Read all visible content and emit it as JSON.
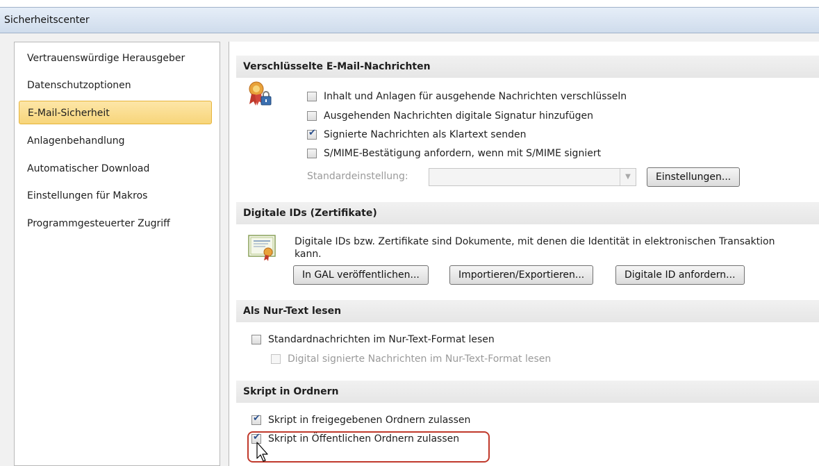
{
  "window": {
    "title": "Sicherheitscenter"
  },
  "sidebar": {
    "items": [
      {
        "label": "Vertrauenswürdige Herausgeber"
      },
      {
        "label": "Datenschutzoptionen"
      },
      {
        "label": "E-Mail-Sicherheit",
        "selected": true
      },
      {
        "label": "Anlagenbehandlung"
      },
      {
        "label": "Automatischer Download"
      },
      {
        "label": "Einstellungen für Makros"
      },
      {
        "label": "Programmgesteuerter Zugriff"
      }
    ]
  },
  "encrypted": {
    "header": "Verschlüsselte E-Mail-Nachrichten",
    "options": [
      {
        "label": "Inhalt und Anlagen für ausgehende Nachrichten verschlüsseln",
        "checked": false
      },
      {
        "label": "Ausgehenden Nachrichten digitale Signatur hinzufügen",
        "checked": false
      },
      {
        "label": "Signierte Nachrichten als Klartext senden",
        "checked": true
      },
      {
        "label": "S/MIME-Bestätigung anfordern, wenn mit S/MIME signiert",
        "checked": false
      }
    ],
    "default_setting_label": "Standardeinstellung:",
    "default_setting_value": "",
    "settings_button": "Einstellungen..."
  },
  "digital_ids": {
    "header": "Digitale IDs (Zertifikate)",
    "description_line1": "Digitale IDs bzw. Zertifikate sind Dokumente, mit denen die Identität in elektronischen Transaktion",
    "description_line2": "kann.",
    "buttons": {
      "publish": "In GAL veröffentlichen...",
      "import_export": "Importieren/Exportieren...",
      "request": "Digitale ID anfordern..."
    }
  },
  "plain_text": {
    "header": "Als Nur-Text lesen",
    "option_standard": {
      "label": "Standardnachrichten im Nur-Text-Format lesen",
      "checked": false
    },
    "option_signed": {
      "label": "Digital signierte Nachrichten im Nur-Text-Format lesen",
      "checked": false,
      "disabled": true
    }
  },
  "scripts": {
    "header": "Skript in Ordnern",
    "option_shared": {
      "label": "Skript in freigegebenen Ordnern zulassen",
      "checked": true
    },
    "option_public": {
      "label": "Skript in Öffentlichen Ordnern zulassen",
      "checked": true
    }
  },
  "colors": {
    "selected_nav_bg": "#f7d57a",
    "highlight_outline": "#c0392b",
    "titlebar": "#cfdcec"
  },
  "icons": {
    "security_badge": "award-lock-icon",
    "certificate": "certificate-icon",
    "cursor": "mouse-pointer-icon"
  }
}
